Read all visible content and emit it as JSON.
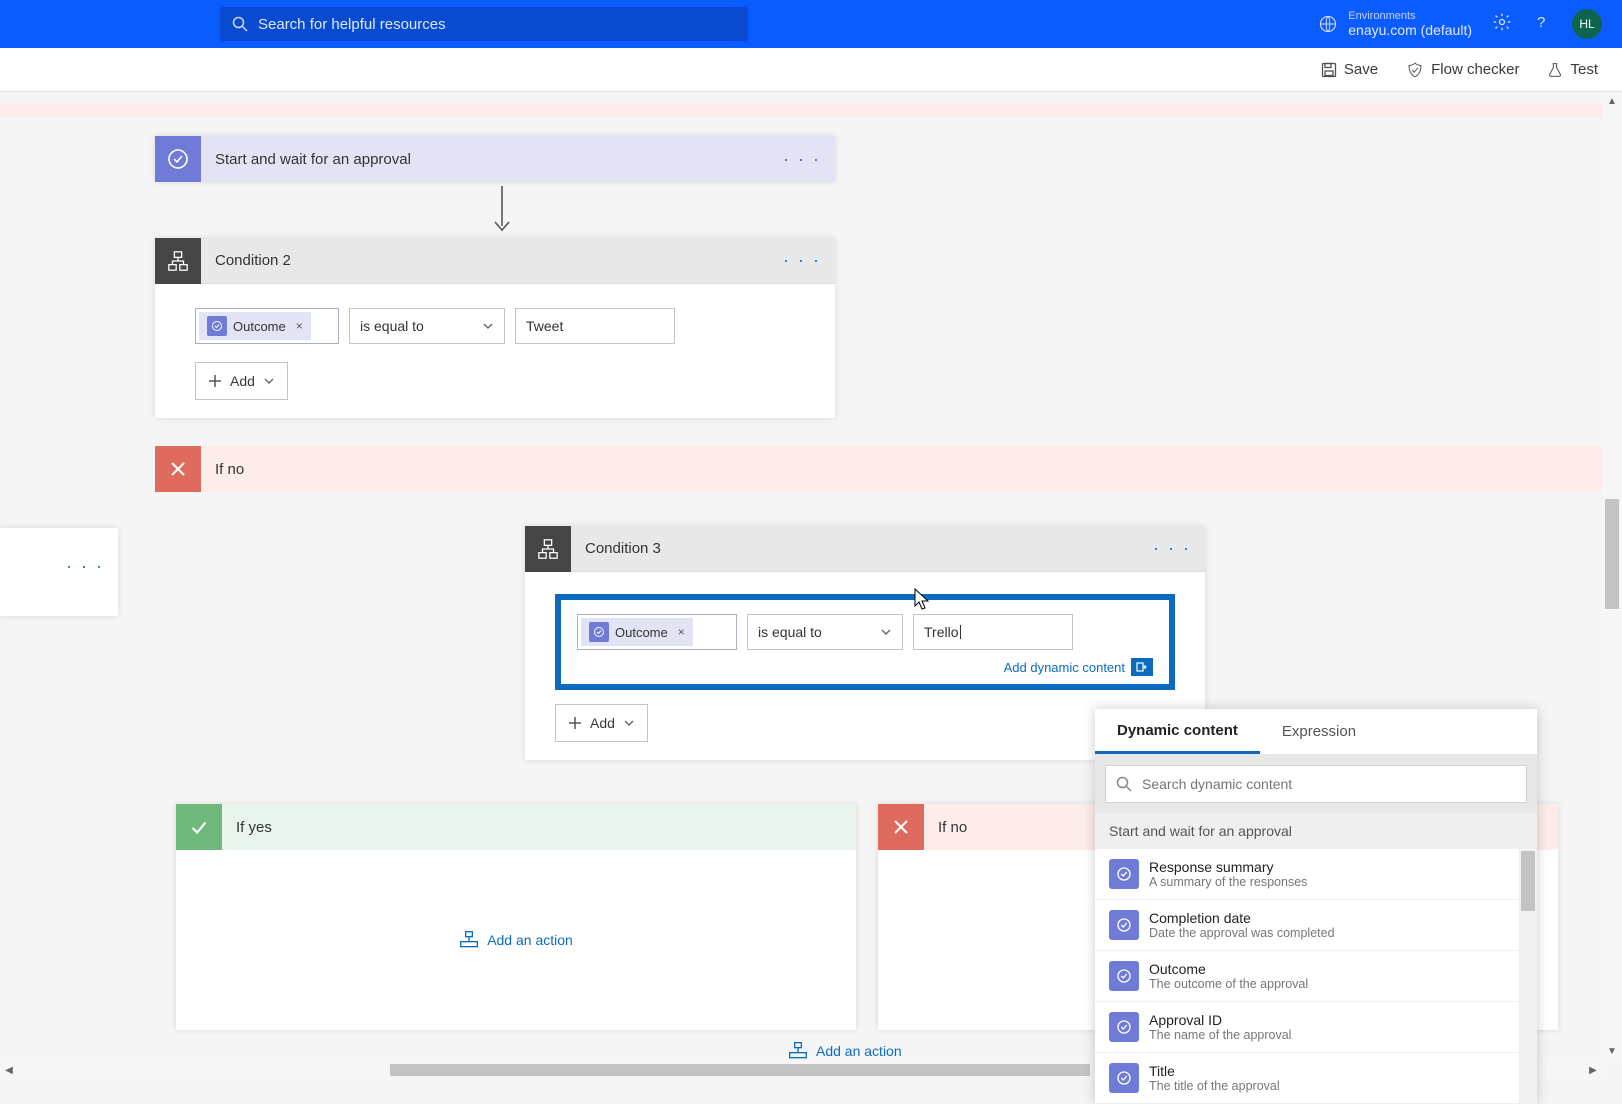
{
  "topbar": {
    "searchPlaceholder": "Search for helpful resources",
    "envLabel": "Environments",
    "envName": "enayu.com (default)",
    "avatar": "HL"
  },
  "cmdbar": {
    "save": "Save",
    "flowChecker": "Flow checker",
    "test": "Test"
  },
  "approvalCard": {
    "title": "Start and wait for an approval"
  },
  "condition2": {
    "title": "Condition 2",
    "tokenLabel": "Outcome",
    "operator": "is equal to",
    "value": "Tweet",
    "addLabel": "Add"
  },
  "ifNoBar": {
    "label": "If no"
  },
  "condition3": {
    "title": "Condition 3",
    "tokenLabel": "Outcome",
    "operator": "is equal to",
    "value": "Trello",
    "addDynamicLink": "Add dynamic content",
    "addLabel": "Add"
  },
  "ifYes2": {
    "label": "If yes",
    "addAction": "Add an action"
  },
  "ifNo2": {
    "label": "If no"
  },
  "bottomAdd": {
    "label": "Add an action"
  },
  "dcPopup": {
    "tabDynamic": "Dynamic content",
    "tabExpression": "Expression",
    "searchPlaceholder": "Search dynamic content",
    "sectionTitle": "Start and wait for an approval",
    "items": [
      {
        "title": "Response summary",
        "desc": "A summary of the responses"
      },
      {
        "title": "Completion date",
        "desc": "Date the approval was completed"
      },
      {
        "title": "Outcome",
        "desc": "The outcome of the approval"
      },
      {
        "title": "Approval ID",
        "desc": "The name of the approval"
      },
      {
        "title": "Title",
        "desc": "The title of the approval"
      }
    ]
  }
}
